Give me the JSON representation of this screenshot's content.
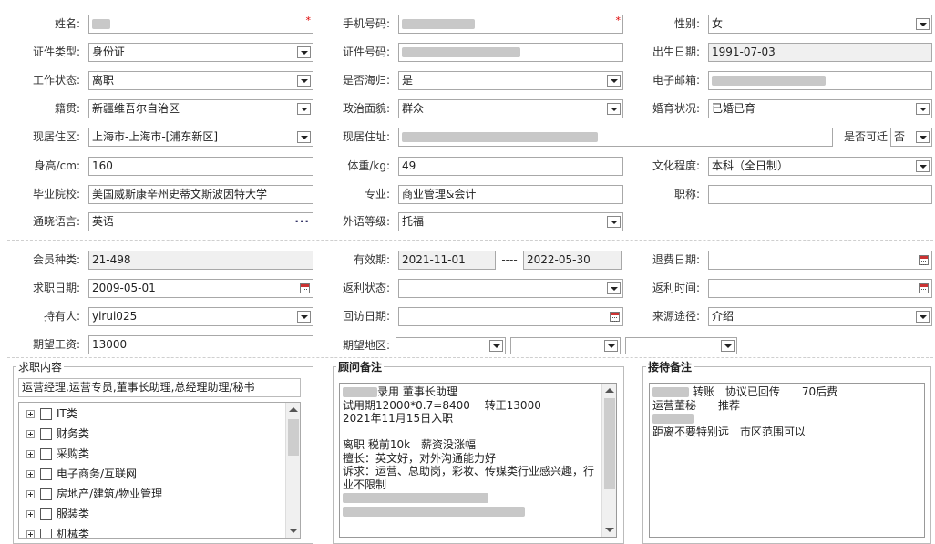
{
  "row1": {
    "name_label": "姓名:",
    "phone_label": "手机号码:",
    "gender_label": "性别:",
    "gender_value": "女",
    "required_mark": "*"
  },
  "row2": {
    "idtype_label": "证件类型:",
    "idtype_value": "身份证",
    "idno_label": "证件号码:",
    "birth_label": "出生日期:",
    "birth_value": "1991-07-03"
  },
  "row3": {
    "workstatus_label": "工作状态:",
    "workstatus_value": "离职",
    "returnee_label": "是否海归:",
    "returnee_value": "是",
    "email_label": "电子邮箱:"
  },
  "row4": {
    "native_label": "籍贯:",
    "native_value": "新疆维吾尔自治区",
    "political_label": "政治面貌:",
    "political_value": "群众",
    "marital_label": "婚育状况:",
    "marital_value": "已婚已育"
  },
  "row5": {
    "residence_label": "现居住区:",
    "residence_value": "上海市-上海市-[浦东新区]",
    "address_label": "现居住址:",
    "relocate_label": "是否可迁",
    "relocate_value": "否"
  },
  "row6": {
    "height_label": "身高/cm:",
    "height_value": "160",
    "weight_label": "体重/kg:",
    "weight_value": "49",
    "education_label": "文化程度:",
    "education_value": "本科（全日制）"
  },
  "row7": {
    "school_label": "毕业院校:",
    "school_value": "美国威斯康辛州史蒂文斯波因特大学",
    "major_label": "专业:",
    "major_value": "商业管理&会计",
    "title_label": "职称:",
    "title_value": ""
  },
  "row8": {
    "language_label": "通晓语言:",
    "language_value": "英语",
    "level_label": "外语等级:",
    "level_value": "托福"
  },
  "row9": {
    "member_label": "会员种类:",
    "member_value": "21-498",
    "valid_label": "有效期:",
    "valid_from": "2021-11-01",
    "valid_sep": "----",
    "valid_to": "2022-05-30",
    "refund_label": "退费日期:"
  },
  "row10": {
    "jobdate_label": "求职日期:",
    "jobdate_value": "2009-05-01",
    "rebate_status_label": "返利状态:",
    "rebate_time_label": "返利时间:"
  },
  "row11": {
    "holder_label": "持有人:",
    "holder_value": "yirui025",
    "revisit_label": "回访日期:",
    "source_label": "来源途径:",
    "source_value": "介绍"
  },
  "row12": {
    "salary_label": "期望工资:",
    "salary_value": "13000",
    "region_label": "期望地区:"
  },
  "job": {
    "title": "求职内容",
    "summary": "运营经理,运营专员,董事长助理,总经理助理/秘书",
    "categories": [
      "IT类",
      "财务类",
      "采购类",
      "电子商务/互联网",
      "房地产/建筑/物业管理",
      "服装类",
      "机械类"
    ]
  },
  "advisor": {
    "title": "顾问备注",
    "lines": [
      "录用 董事长助理",
      "试用期12000*0.7=8400　 转正13000",
      "2021年11月15日入职",
      "",
      "离职 税前10k　薪资没涨幅",
      "擅长：英文好，对外沟通能力好",
      "诉求：运营、总助岗，彩妆、传媒类行业感兴趣，行",
      "业不限制"
    ]
  },
  "reception": {
    "title": "接待备注",
    "lines": [
      "转账　协议已回传　　70后费",
      "运营董秘　　推荐",
      "",
      "距离不要特别远　市区范围可以"
    ]
  }
}
